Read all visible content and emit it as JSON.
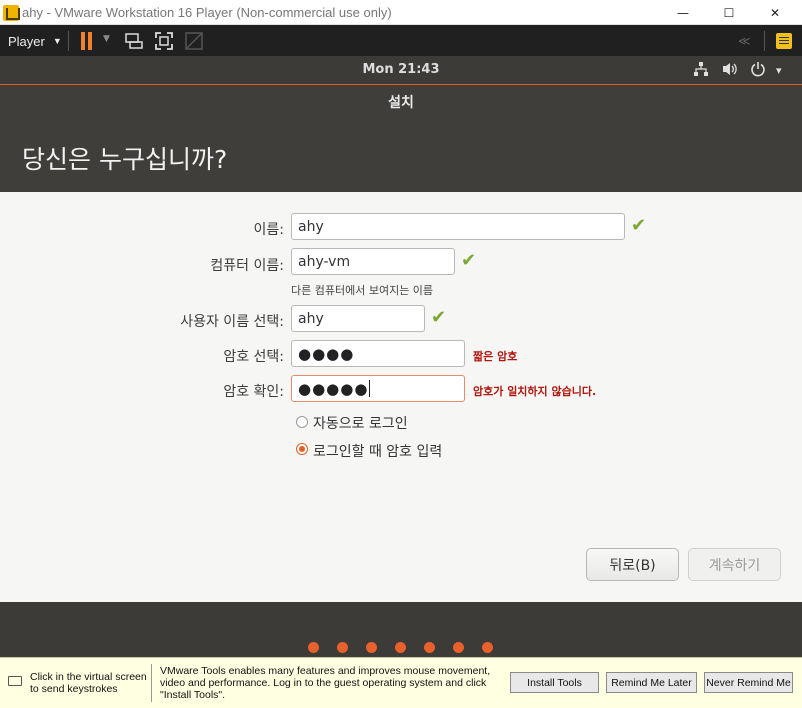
{
  "window": {
    "title": "ahy - VMware Workstation 16 Player (Non-commercial use only)",
    "minimize": "—",
    "maximize": "☐",
    "close": "✕"
  },
  "vm_toolbar": {
    "player_menu": "Player",
    "icons": [
      "pause-icon",
      "send-ctrl-alt-del-icon",
      "fullscreen-icon",
      "unity-icon",
      "notes-icon"
    ]
  },
  "panel": {
    "clock": "Mon 21:43",
    "network_icon": "⊞",
    "volume_icon": "🔊",
    "power_icon": "⏻",
    "menu_caret": "▾"
  },
  "installer": {
    "title": "설치",
    "heading": "당신은 누구십니까?",
    "fields": {
      "name_label": "이름:",
      "name_value": "ahy",
      "computer_label": "컴퓨터 이름:",
      "computer_value": "ahy-vm",
      "computer_hint": "다른 컴퓨터에서 보여지는 이름",
      "username_label": "사용자 이름 선택:",
      "username_value": "ahy",
      "password_label": "암호 선택:",
      "password_value": "●●●●",
      "password_error": "짧은 암호",
      "confirm_label": "암호 확인:",
      "confirm_value": "●●●●●",
      "confirm_error": "암호가 일치하지 않습니다."
    },
    "options": {
      "auto_login": "자동으로 로그인",
      "require_password": "로그인할 때 암호 입력",
      "selected": "require_password"
    },
    "buttons": {
      "back": "뒤로(B)",
      "continue": "계속하기"
    },
    "check_mark": "✔",
    "progress": {
      "total_steps": 7
    }
  },
  "tools_bar": {
    "hint": "Click in the virtual screen to send keystrokes",
    "message": "VMware Tools enables many features and improves mouse movement, video and performance. Log in to the guest operating system and click \"Install Tools\".",
    "install": "Install Tools",
    "remind_later": "Remind Me Later",
    "never_remind": "Never Remind Me"
  }
}
